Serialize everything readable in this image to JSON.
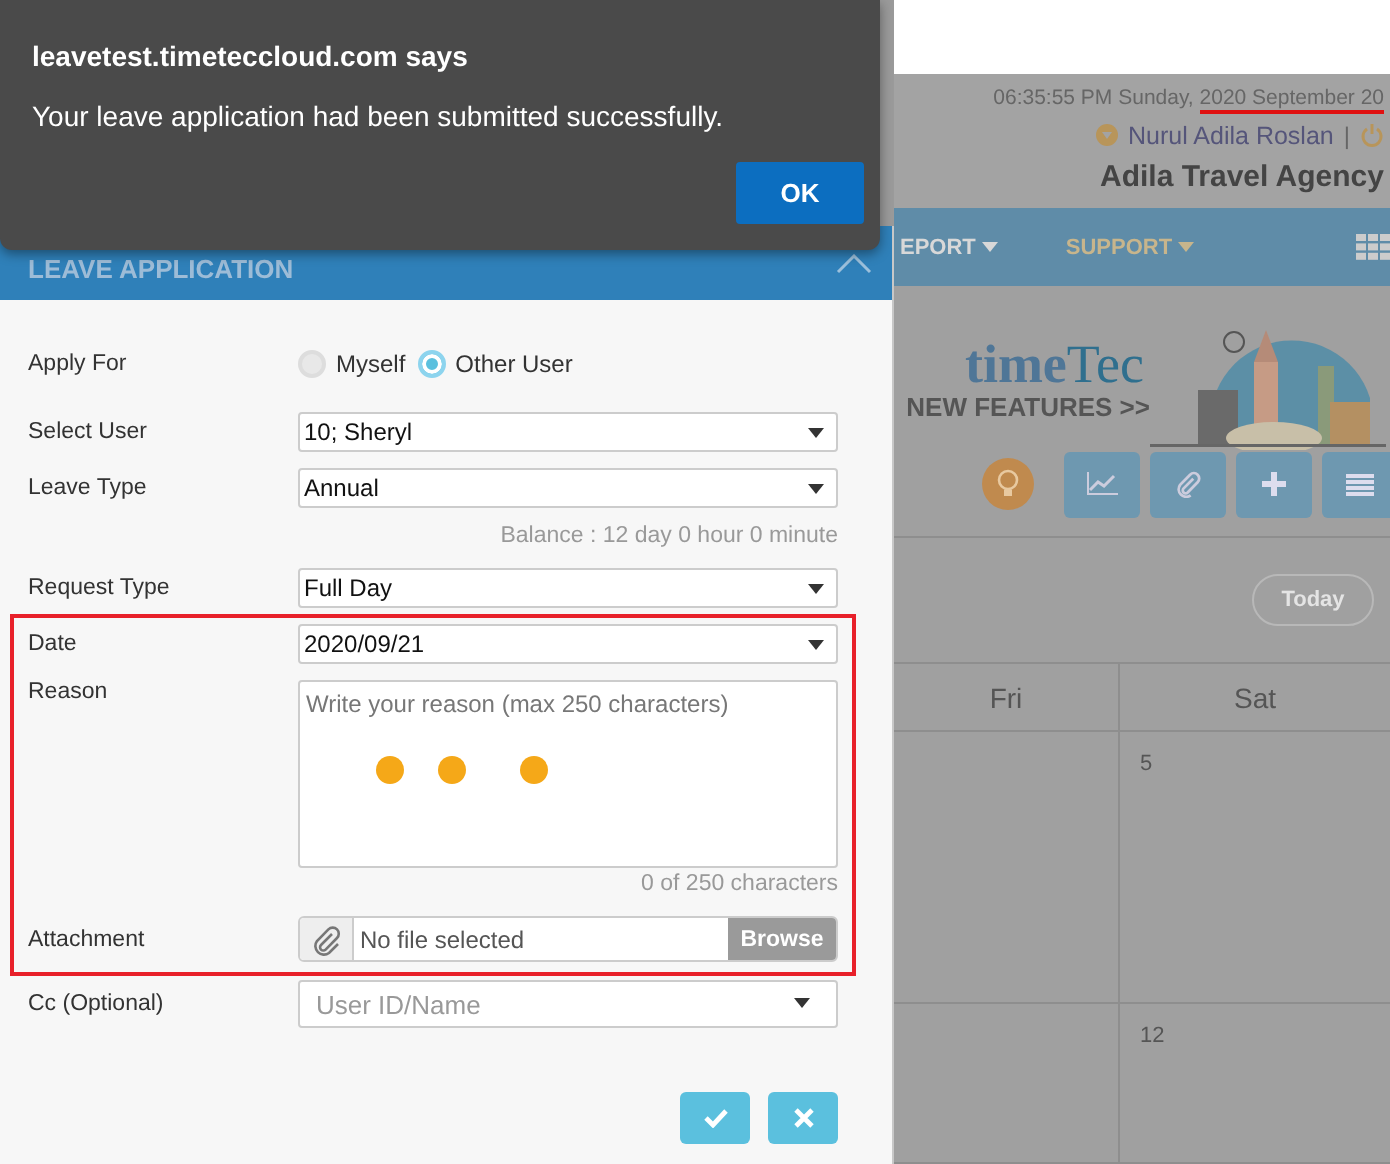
{
  "alert": {
    "title": "leavetest.timeteccloud.com says",
    "message": "Your leave application had been submitted successfully.",
    "button": "OK"
  },
  "header": {
    "datetime": "06:35:55 PM Sunday, ",
    "date": "2020 September 20",
    "user": "Nurul Adila Roslan",
    "separator": "|",
    "company": "Adila Travel Agency"
  },
  "nav": [
    {
      "label": "EPORT"
    },
    {
      "label": "SUPPORT"
    }
  ],
  "banner": {
    "logo_parts": [
      "time",
      "Tec"
    ],
    "tagline": "NEW FEATURES >>"
  },
  "today_button": "Today",
  "calendar": {
    "columns": [
      "Fri",
      "Sat"
    ],
    "rows": [
      {
        "sat": "5"
      },
      {
        "sat": "12"
      }
    ]
  },
  "dialog": {
    "title": "LEAVE APPLICATION",
    "apply_for": {
      "label": "Apply For",
      "options": [
        {
          "label": "Myself",
          "selected": false
        },
        {
          "label": "Other User",
          "selected": true
        }
      ]
    },
    "select_user": {
      "label": "Select User",
      "value": "10; Sheryl"
    },
    "leave_type": {
      "label": "Leave Type",
      "value": "Annual"
    },
    "balance": "Balance : 12 day 0 hour 0 minute",
    "request_type": {
      "label": "Request Type",
      "value": "Full Day"
    },
    "date": {
      "label": "Date",
      "value": "2020/09/21"
    },
    "reason": {
      "label": "Reason",
      "placeholder": "Write your reason (max 250 characters)",
      "count": "0 of 250 characters"
    },
    "attachment": {
      "label": "Attachment",
      "value": "No file selected",
      "button": "Browse"
    },
    "cc": {
      "label": "Cc (Optional)",
      "placeholder": "User ID/Name"
    }
  }
}
